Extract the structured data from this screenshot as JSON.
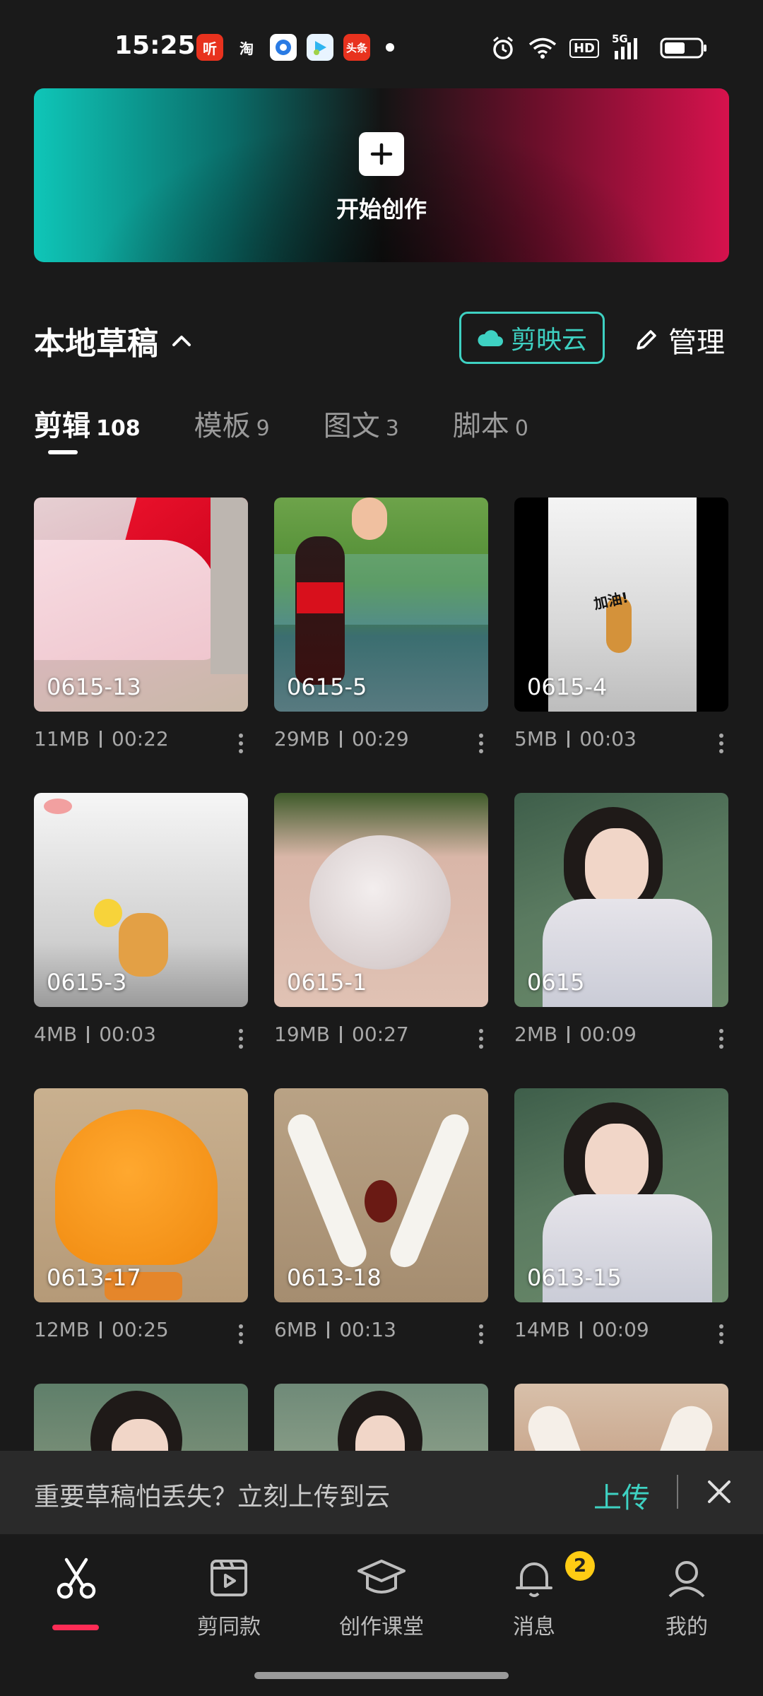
{
  "status_bar": {
    "time": "15:25",
    "apps": [
      {
        "icon": "ting-app-icon",
        "label": "听",
        "color": "#e8321e"
      },
      {
        "icon": "taobao-app-icon",
        "label": "淘",
        "color": "#1a1a1a"
      },
      {
        "icon": "browser-app-icon",
        "label": "",
        "color": "#2a7be4"
      },
      {
        "icon": "video-app-icon",
        "label": "",
        "color": "#2fb5f0"
      },
      {
        "icon": "toutiao-app-icon",
        "label": "头条",
        "color": "#e8321e"
      }
    ],
    "network": "5G",
    "hd_badge": "HD"
  },
  "hero": {
    "label": "开始创作"
  },
  "section": {
    "title": "本地草稿",
    "cloud_button": "剪映云",
    "manage_button": "管理"
  },
  "tabs": [
    {
      "label": "剪辑",
      "count": "108",
      "active": true
    },
    {
      "label": "模板",
      "count": "9",
      "active": false
    },
    {
      "label": "图文",
      "count": "3",
      "active": false
    },
    {
      "label": "脚本",
      "count": "0",
      "active": false
    }
  ],
  "drafts": [
    {
      "name": "0615-13",
      "size": "11MB",
      "duration": "00:22"
    },
    {
      "name": "0615-5",
      "size": "29MB",
      "duration": "00:29"
    },
    {
      "name": "0615-4",
      "size": "5MB",
      "duration": "00:03"
    },
    {
      "name": "0615-3",
      "size": "4MB",
      "duration": "00:03"
    },
    {
      "name": "0615-1",
      "size": "19MB",
      "duration": "00:27"
    },
    {
      "name": "0615",
      "size": "2MB",
      "duration": "00:09"
    },
    {
      "name": "0613-17",
      "size": "12MB",
      "duration": "00:25"
    },
    {
      "name": "0613-18",
      "size": "6MB",
      "duration": "00:13"
    },
    {
      "name": "0613-15",
      "size": "14MB",
      "duration": "00:09"
    }
  ],
  "banner": {
    "text": "重要草稿怕丢失？立刻上传到云",
    "upload": "上传"
  },
  "nav": {
    "items": [
      {
        "label": "",
        "icon": "scissors-icon",
        "active": true
      },
      {
        "label": "剪同款",
        "icon": "clapperboard-icon"
      },
      {
        "label": "创作课堂",
        "icon": "graduation-cap-icon"
      },
      {
        "label": "消息",
        "icon": "bell-icon"
      },
      {
        "label": "我的",
        "icon": "user-icon"
      }
    ],
    "message_badge": "2"
  },
  "colors": {
    "accent": "#3ed1c2",
    "active_nav": "#fe2c55",
    "badge": "#ffcc14"
  }
}
